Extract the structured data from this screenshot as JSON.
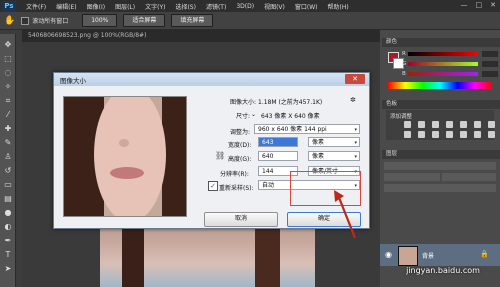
{
  "menubar": {
    "logo": "Ps",
    "items": [
      "文件(F)",
      "编辑(E)",
      "图像(I)",
      "图层(L)",
      "文字(Y)",
      "选择(S)",
      "滤镜(T)",
      "3D(D)",
      "视图(V)",
      "窗口(W)",
      "帮助(H)"
    ],
    "window_controls": [
      "—",
      "□",
      "✕"
    ]
  },
  "optbar": {
    "scroll_all": "滚动所有窗口",
    "zoom_100": "100%",
    "fit_screen": "适合屏幕",
    "fill_screen": "填充屏幕"
  },
  "document": {
    "tab": "5406806698523.png @ 100%(RGB/8#)"
  },
  "panels": {
    "color_tab": "颜色",
    "swatch_tab": "色板",
    "adjust_label": "添加调整",
    "layers_tab": "图层",
    "layer_name": "背景"
  },
  "dialog": {
    "title": "图像大小",
    "image_size_label": "图像大小:",
    "image_size_value": "1.18M (之前为457.1K)",
    "dimension_label": "尺寸:",
    "dimension_value": "643 像素 X 640 像素",
    "fit_to_label": "调整为:",
    "fit_to_value": "960 x 640 像素 144 ppi",
    "width_label": "宽度(D):",
    "width_value": "643",
    "width_unit": "像素",
    "height_label": "高度(G):",
    "height_value": "640",
    "height_unit": "像素",
    "resolution_label": "分辨率(R):",
    "resolution_value": "144",
    "resolution_unit": "像素/英寸",
    "resample_label": "重新采样(S):",
    "resample_value": "自动",
    "cancel": "取消",
    "ok": "确定"
  },
  "watermark": "jingyan.baidu.com",
  "colors": {
    "accent_highlight": "#e0453a",
    "layer_selected": "#5d6e82"
  }
}
